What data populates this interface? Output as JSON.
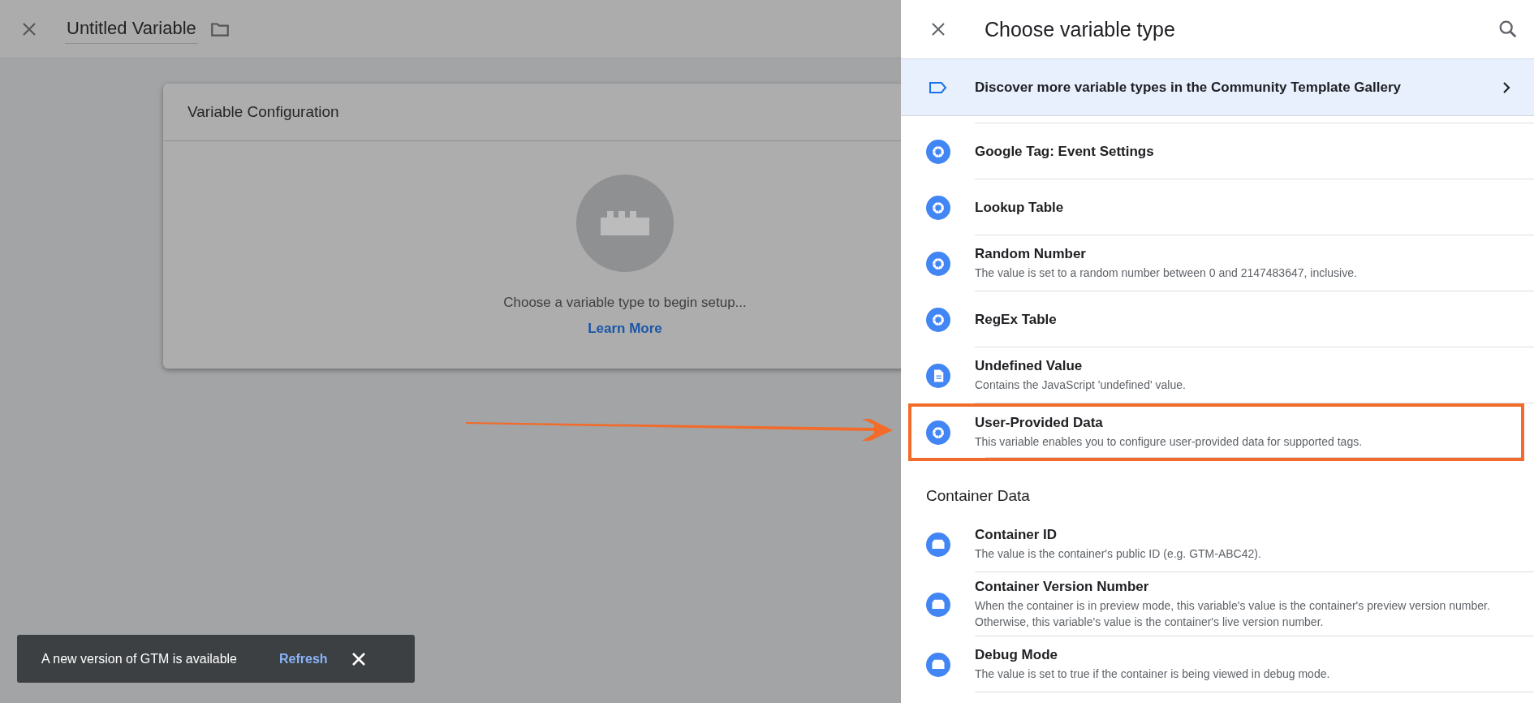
{
  "editor": {
    "title": "Untitled Variable",
    "card": {
      "title": "Variable Configuration",
      "hint": "Choose a variable type to begin setup...",
      "link": "Learn More"
    }
  },
  "panel": {
    "title": "Choose variable type",
    "banner": "Discover more variable types in the Community Template Gallery",
    "sections": [
      {
        "items": [
          {
            "kind": "gear",
            "name": "Google Tag: Event Settings",
            "highlighted": false
          },
          {
            "kind": "gear",
            "name": "Lookup Table",
            "highlighted": false
          },
          {
            "kind": "gear",
            "name": "Random Number",
            "description": "The value is set to a random number between 0 and 2147483647, inclusive.",
            "highlighted": false
          },
          {
            "kind": "gear",
            "name": "RegEx Table",
            "highlighted": false
          },
          {
            "kind": "doc",
            "name": "Undefined Value",
            "description": "Contains the JavaScript 'undefined' value.",
            "highlighted": false
          },
          {
            "kind": "gear",
            "name": "User-Provided Data",
            "description": "This variable enables you to configure user-provided data for supported tags.",
            "highlighted": true
          }
        ]
      },
      {
        "heading": "Container Data",
        "items": [
          {
            "kind": "container",
            "name": "Container ID",
            "description": "The value is the container's public ID (e.g. GTM-ABC42).",
            "highlighted": false
          },
          {
            "kind": "container",
            "name": "Container Version Number",
            "description": "When the container is in preview mode, this variable's value is the container's preview version number. Otherwise, this variable's value is the container's live version number.",
            "highlighted": false
          },
          {
            "kind": "container",
            "name": "Debug Mode",
            "description": "The value is set to true if the container is being viewed in debug mode.",
            "highlighted": false
          }
        ]
      }
    ]
  },
  "snackbar": {
    "message": "A new version of GTM is available",
    "action": "Refresh"
  }
}
